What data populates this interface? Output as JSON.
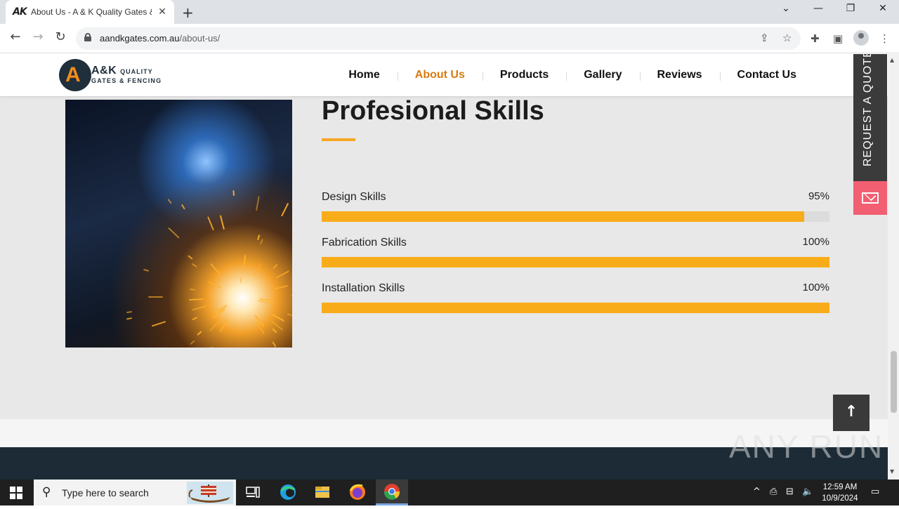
{
  "browser": {
    "tab_title": "About Us - A & K Quality Gates &",
    "tab_favicon": "AK",
    "new_tab": "+",
    "url_domain": "aandkgates.com.au",
    "url_path": "/about-us/",
    "icons": [
      "back-icon",
      "forward-icon",
      "reload-icon",
      "lock-icon",
      "share-icon",
      "star-icon",
      "extensions-icon",
      "sidepanel-icon",
      "profile-icon",
      "menu-icon",
      "tab-list-icon",
      "minimize-icon",
      "restore-icon",
      "close-icon"
    ]
  },
  "site": {
    "logo_main": "A&K",
    "logo_quality": "QUALITY",
    "logo_sub": "GATES & FENCING",
    "nav": [
      {
        "label": "Home"
      },
      {
        "label": "About Us",
        "active": true
      },
      {
        "label": "Products"
      },
      {
        "label": "Gallery"
      },
      {
        "label": "Reviews"
      },
      {
        "label": "Contact Us"
      }
    ],
    "section_title": "Profesional Skills",
    "skills": [
      {
        "label": "Design Skills",
        "percent_text": "95%",
        "percent": 95
      },
      {
        "label": "Fabrication Skills",
        "percent_text": "100%",
        "percent": 100
      },
      {
        "label": "Installation Skills",
        "percent_text": "100%",
        "percent": 100
      }
    ],
    "quote_tab": "REQUEST A QUOTE",
    "accent_color": "#f9ac19",
    "nav_active_color": "#d97a0e"
  },
  "watermark": "ANY RUN",
  "taskbar": {
    "search_placeholder": "Type here to search",
    "time": "12:59 AM",
    "date": "10/9/2024"
  }
}
